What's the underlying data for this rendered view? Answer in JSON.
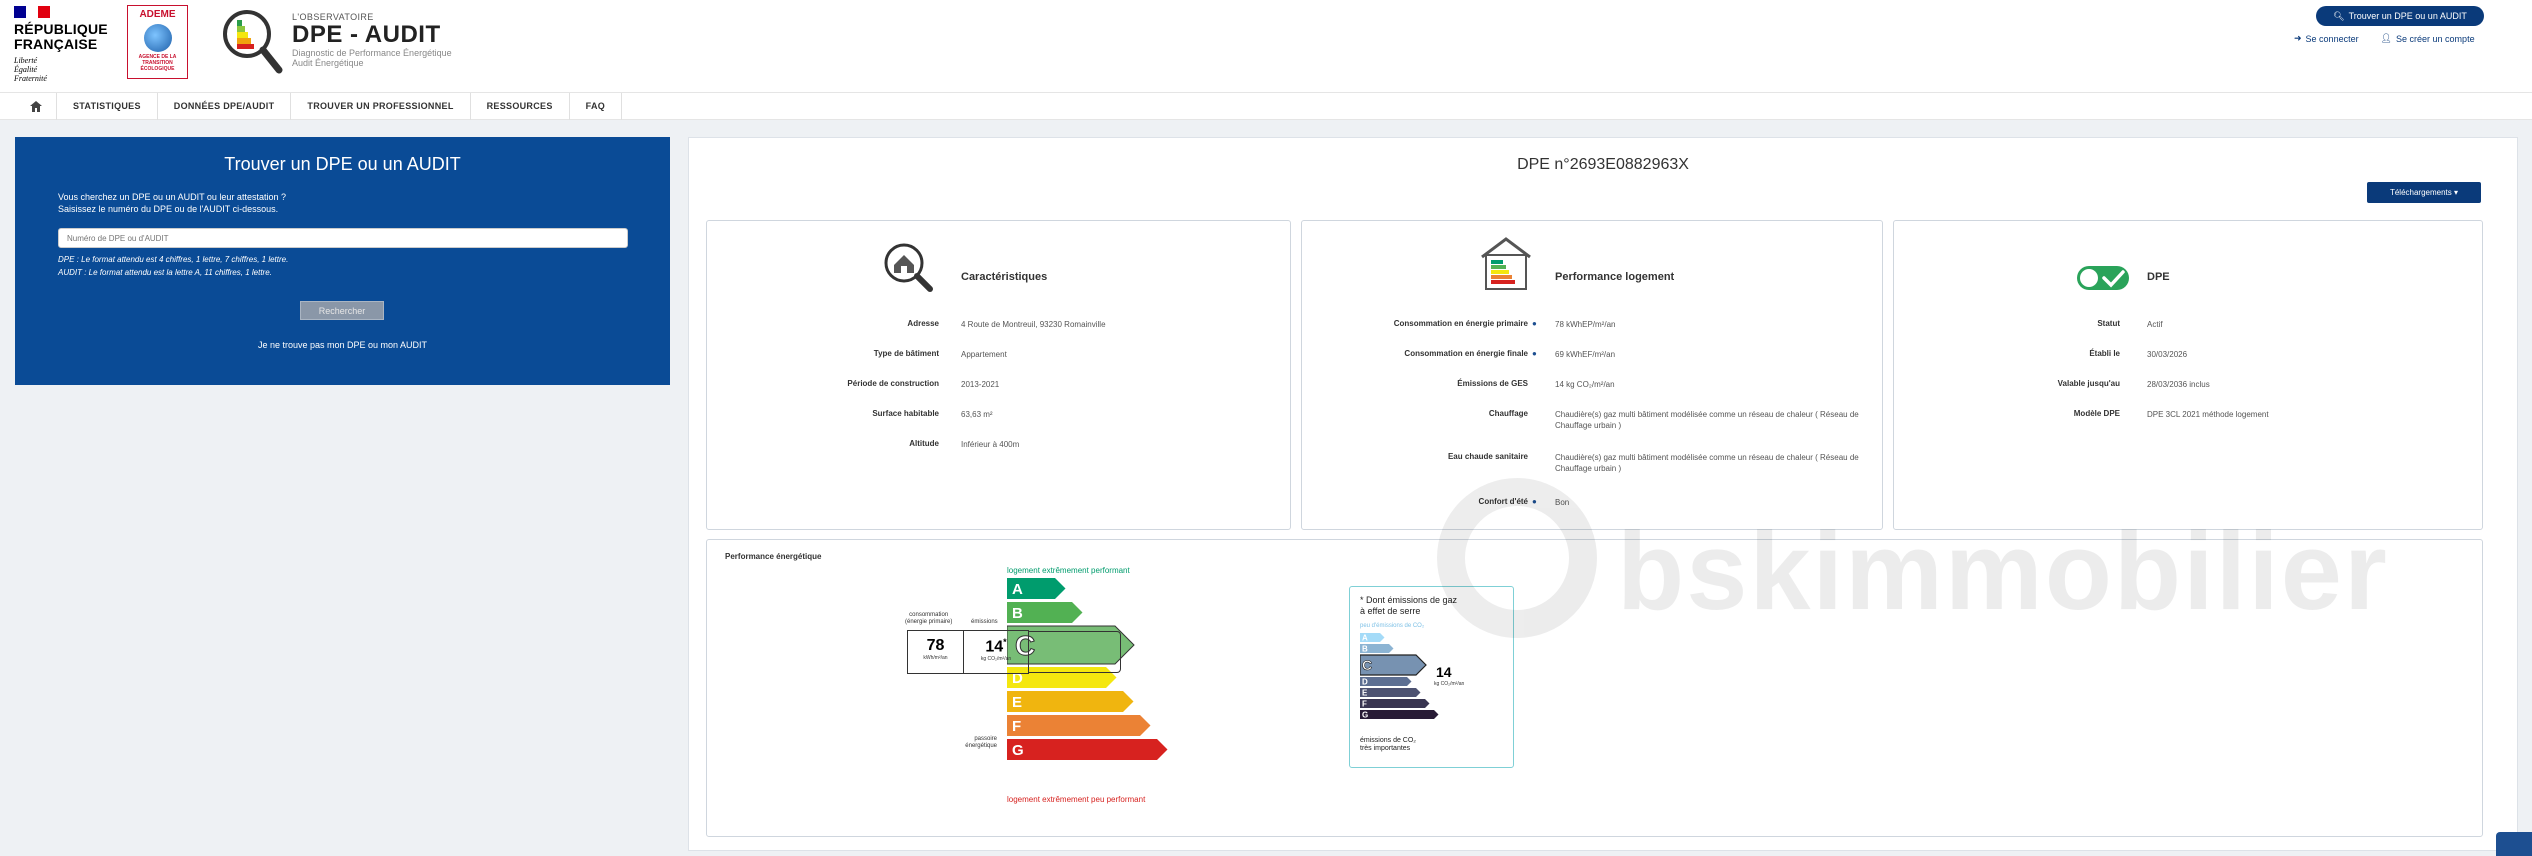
{
  "header": {
    "rf_title_line1": "RÉPUBLIQUE",
    "rf_title_line2": "FRANÇAISE",
    "rf_motto_1": "Liberté",
    "rf_motto_2": "Égalité",
    "rf_motto_3": "Fraternité",
    "ademe_title": "ADEME",
    "ademe_sub": "AGENCE DE LA TRANSITION ÉCOLOGIQUE",
    "obs_small": "L'OBSERVATOIRE",
    "obs_title": "DPE - AUDIT",
    "obs_sub1": "Diagnostic de Performance Énergétique",
    "obs_sub2": "Audit Énergétique",
    "find_button": "Trouver un DPE ou un AUDIT",
    "login": "Se connecter",
    "signup": "Se créer un compte"
  },
  "nav": {
    "items": [
      "STATISTIQUES",
      "DONNÉES DPE/AUDIT",
      "TROUVER UN PROFESSIONNEL",
      "RESSOURCES",
      "FAQ"
    ]
  },
  "search": {
    "title": "Trouver un DPE ou un AUDIT",
    "desc1": "Vous cherchez un DPE ou un AUDIT ou leur attestation ?",
    "desc2": "Saisissez le numéro du DPE ou de l'AUDIT ci-dessous.",
    "placeholder": "Numéro de DPE ou d'AUDIT",
    "help1": "DPE : Le format attendu est 4 chiffres, 1 lettre, 7 chiffres, 1 lettre.",
    "help2": "AUDIT : Le format attendu est la lettre A, 11 chiffres, 1 lettre.",
    "button": "Rechercher",
    "not_found": "Je ne trouve pas mon DPE ou mon AUDIT"
  },
  "dpe": {
    "title": "DPE n°2693E0882963X",
    "downloads": "Téléchargements ▾"
  },
  "caracteristiques": {
    "title": "Caractéristiques",
    "rows": [
      {
        "label": "Adresse",
        "value": "4 Route de Montreuil, 93230 Romainville"
      },
      {
        "label": "Type de bâtiment",
        "value": "Appartement"
      },
      {
        "label": "Période de construction",
        "value": "2013-2021"
      },
      {
        "label": "Surface habitable",
        "value": "63,63 m²"
      },
      {
        "label": "Altitude",
        "value": "Inférieur à 400m"
      }
    ]
  },
  "performance": {
    "title": "Performance logement",
    "rows": [
      {
        "label": "Consommation en énergie primaire",
        "value": "78 kWhEP/m²/an"
      },
      {
        "label": "Consommation en énergie finale",
        "value": "69 kWhEF/m²/an"
      },
      {
        "label": "Émissions de GES",
        "value": "14 kg CO₂/m²/an"
      },
      {
        "label": "Chauffage",
        "value": "Chaudière(s) gaz multi bâtiment modélisée comme un réseau de chaleur ( Réseau de Chauffage urbain )"
      },
      {
        "label": "Eau chaude sanitaire",
        "value": "Chaudière(s) gaz multi bâtiment modélisée comme un réseau de chaleur ( Réseau de Chauffage urbain )"
      },
      {
        "label": "Confort d'été",
        "value": "Bon"
      }
    ]
  },
  "status": {
    "title": "DPE",
    "rows": [
      {
        "label": "Statut",
        "value": "Actif"
      },
      {
        "label": "Établi le",
        "value": "30/03/2026"
      },
      {
        "label": "Valable jusqu'au",
        "value": "28/03/2036 inclus"
      },
      {
        "label": "Modèle DPE",
        "value": "DPE 3CL 2021 méthode logement"
      }
    ]
  },
  "energy_label": {
    "section_title": "Performance énergétique",
    "top_caption": "logement extrêmement performant",
    "bottom_caption": "logement extrêmement peu performant",
    "conso_label": "consommation",
    "conso_sub": "(énergie primaire)",
    "emissions_label": "émissions",
    "conso_value": "78",
    "conso_unit": "kWh/m²/an",
    "emis_value": "14",
    "emis_unit": "kg CO₂/m²/an",
    "emis_star": "*",
    "passoire": "passoire énergétique",
    "active_class": "C",
    "classes": [
      {
        "letter": "A",
        "color": "#009c6d"
      },
      {
        "letter": "B",
        "color": "#52b153"
      },
      {
        "letter": "C",
        "color": "#78bd76"
      },
      {
        "letter": "D",
        "color": "#f4e70f"
      },
      {
        "letter": "E",
        "color": "#f0b50f"
      },
      {
        "letter": "F",
        "color": "#eb8235"
      },
      {
        "letter": "G",
        "color": "#d7221f"
      }
    ]
  },
  "ges_label": {
    "title1": "* Dont émissions de gaz",
    "title2": "à effet de serre",
    "top_caption": "peu d'émissions de CO₂",
    "bottom1": "émissions de CO₂",
    "bottom2": "très importantes",
    "value": "14",
    "unit": "kg CO₂/m²/an",
    "active_class": "C",
    "classes": [
      {
        "letter": "A",
        "color": "#a4dbf8"
      },
      {
        "letter": "B",
        "color": "#8cb4d3"
      },
      {
        "letter": "C",
        "color": "#7792b1"
      },
      {
        "letter": "D",
        "color": "#5d6f92"
      },
      {
        "letter": "E",
        "color": "#4d5271"
      },
      {
        "letter": "F",
        "color": "#393551"
      },
      {
        "letter": "G",
        "color": "#281b35"
      }
    ]
  },
  "watermark": "bskimmobilier"
}
